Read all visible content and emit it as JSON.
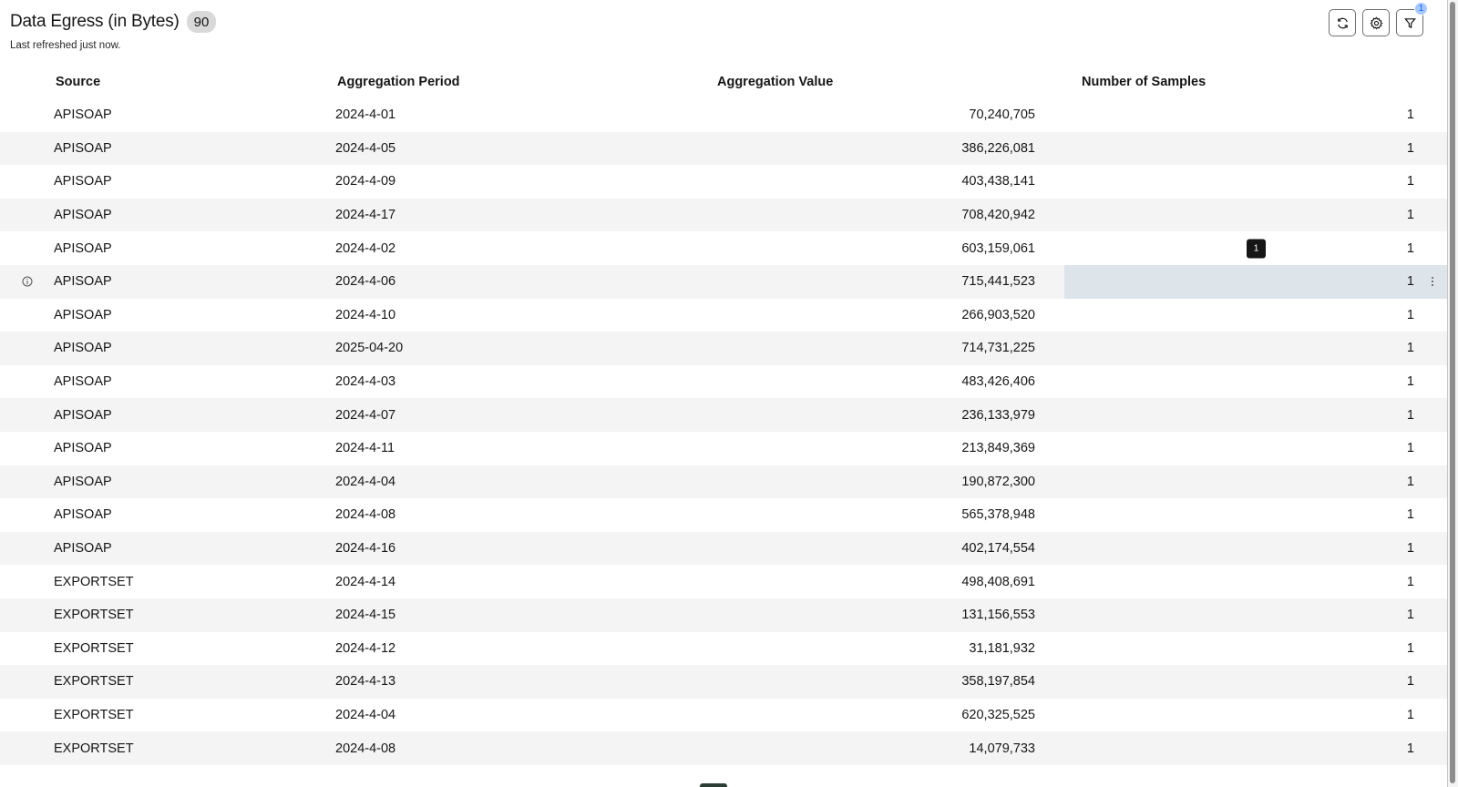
{
  "header": {
    "title": "Data Egress (in Bytes)",
    "count": "90",
    "subtitle": "Last refreshed just now.",
    "refresh_icon": "refresh-icon",
    "settings_icon": "gear-icon",
    "filter_icon": "filter-icon",
    "filter_count": "1"
  },
  "table": {
    "columns": [
      "Source",
      "Aggregation Period",
      "Aggregation Value",
      "Number of Samples"
    ],
    "rows": [
      {
        "source": "APISOAP",
        "period": "2024-4-01",
        "value": "70,240,705",
        "samples": "1"
      },
      {
        "source": "APISOAP",
        "period": "2024-4-05",
        "value": "386,226,081",
        "samples": "1"
      },
      {
        "source": "APISOAP",
        "period": "2024-4-09",
        "value": "403,438,141",
        "samples": "1"
      },
      {
        "source": "APISOAP",
        "period": "2024-4-17",
        "value": "708,420,942",
        "samples": "1"
      },
      {
        "source": "APISOAP",
        "period": "2024-4-02",
        "value": "603,159,061",
        "samples": "1"
      },
      {
        "source": "APISOAP",
        "period": "2024-4-06",
        "value": "715,441,523",
        "samples": "1"
      },
      {
        "source": "APISOAP",
        "period": "2024-4-10",
        "value": "266,903,520",
        "samples": "1"
      },
      {
        "source": "APISOAP",
        "period": "2025-04-20",
        "value": "714,731,225",
        "samples": "1"
      },
      {
        "source": "APISOAP",
        "period": "2024-4-03",
        "value": "483,426,406",
        "samples": "1"
      },
      {
        "source": "APISOAP",
        "period": "2024-4-07",
        "value": "236,133,979",
        "samples": "1"
      },
      {
        "source": "APISOAP",
        "period": "2024-4-11",
        "value": "213,849,369",
        "samples": "1"
      },
      {
        "source": "APISOAP",
        "period": "2024-4-04",
        "value": "190,872,300",
        "samples": "1"
      },
      {
        "source": "APISOAP",
        "period": "2024-4-08",
        "value": "565,378,948",
        "samples": "1"
      },
      {
        "source": "APISOAP",
        "period": "2024-4-16",
        "value": "402,174,554",
        "samples": "1"
      },
      {
        "source": "EXPORTSET",
        "period": "2024-4-14",
        "value": "498,408,691",
        "samples": "1"
      },
      {
        "source": "EXPORTSET",
        "period": "2024-4-15",
        "value": "131,156,553",
        "samples": "1"
      },
      {
        "source": "EXPORTSET",
        "period": "2024-4-12",
        "value": "31,181,932",
        "samples": "1"
      },
      {
        "source": "EXPORTSET",
        "period": "2024-4-13",
        "value": "358,197,854",
        "samples": "1"
      },
      {
        "source": "EXPORTSET",
        "period": "2024-4-04",
        "value": "620,325,525",
        "samples": "1"
      },
      {
        "source": "EXPORTSET",
        "period": "2024-4-08",
        "value": "14,079,733",
        "samples": "1"
      }
    ],
    "active_row_index": 5,
    "tooltip_row_index": 4,
    "tooltip_text": "1"
  },
  "colors": {
    "text": "#161616",
    "row_alt": "#f4f4f4",
    "active_cell": "#dde5ea",
    "badge": "#d9d9d9",
    "tooltip": "#161616",
    "filter_badge": "#a6c8ff"
  }
}
